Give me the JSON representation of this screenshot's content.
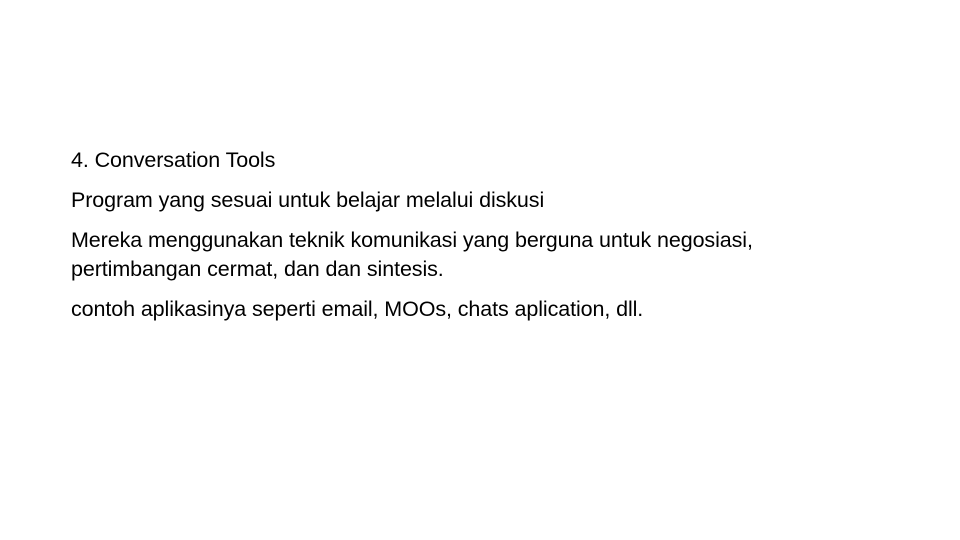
{
  "slide": {
    "background_color": "#ffffff",
    "text_color": "#000000",
    "body": {
      "heading": "4. Conversation Tools",
      "paragraphs": [
        "Program yang sesuai untuk belajar melalui diskusi",
        "Mereka menggunakan teknik komunikasi yang berguna untuk negosiasi, pertimbangan cermat, dan dan sintesis.",
        "contoh aplikasinya seperti email, MOOs, chats aplication, dll."
      ]
    }
  }
}
